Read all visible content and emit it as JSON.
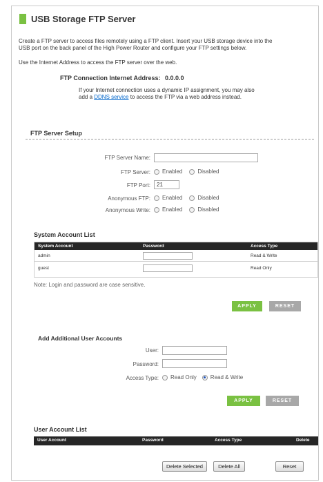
{
  "page": {
    "title": "USB Storage FTP Server",
    "intro_line1": "Create a FTP server to access files remotely using a FTP client. Insert your USB storage device into the",
    "intro_line2": "USB port on the back panel of the High Power Router and configure your FTP settings below.",
    "use_address": "Use the Internet Address to access the FTP server over the web.",
    "connection_label": "FTP Connection Internet Address:",
    "connection_value": "0.0.0.0",
    "dynamic_line1": "If your Internet connection uses a dynamic IP assignment, you may also",
    "dynamic_prefix": "add a ",
    "ddns_link": "DDNS service",
    "dynamic_suffix": " to access the FTP via a web address instead.",
    "accent_color": "#7ac142"
  },
  "ftp_setup": {
    "heading": "FTP Server Setup",
    "server_name_label": "FTP Server Name:",
    "server_name_value": "",
    "server_label": "FTP Server:",
    "port_label": "FTP Port:",
    "port_value": "21",
    "anon_ftp_label": "Anonymous FTP:",
    "anon_write_label": "Anonymous Write:",
    "enabled": "Enabled",
    "disabled": "Disabled",
    "server_selected": "none",
    "anon_ftp_selected": "none",
    "anon_write_selected": "none"
  },
  "system_accounts": {
    "heading": "System Account List",
    "columns": [
      "System Account",
      "Password",
      "Access Type"
    ],
    "rows": [
      {
        "account": "admin",
        "password": "",
        "access": "Read & Write"
      },
      {
        "account": "guest",
        "password": "",
        "access": "Read Only"
      }
    ],
    "note": "Note: Login and password are case sensitive.",
    "apply": "APPLY",
    "reset": "RESET"
  },
  "add_user": {
    "heading": "Add Additional User Accounts",
    "user_label": "User:",
    "user_value": "",
    "password_label": "Password:",
    "password_value": "",
    "access_label": "Access Type:",
    "read_only": "Read Only",
    "read_write": "Read & Write",
    "selected": "read_write",
    "apply": "APPLY",
    "reset": "RESET"
  },
  "user_accounts": {
    "heading": "User Account List",
    "columns": [
      "User Account",
      "Password",
      "Access Type",
      "Delete"
    ],
    "delete_selected": "Delete Selected",
    "delete_all": "Delete All",
    "reset": "Reset"
  }
}
